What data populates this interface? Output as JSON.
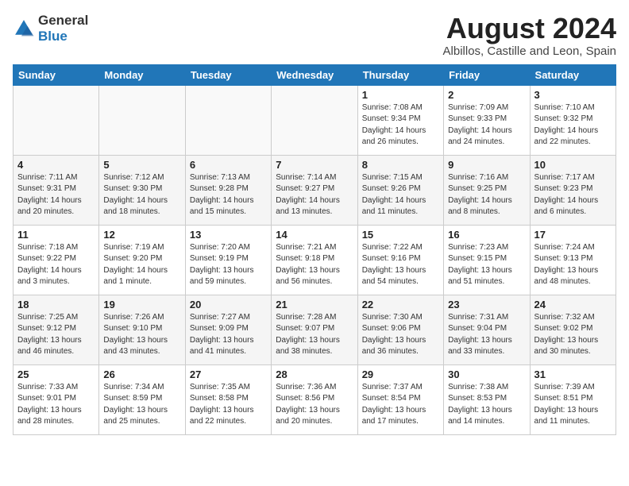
{
  "logo": {
    "text_general": "General",
    "text_blue": "Blue"
  },
  "title": {
    "month_year": "August 2024",
    "location": "Albillos, Castille and Leon, Spain"
  },
  "weekdays": [
    "Sunday",
    "Monday",
    "Tuesday",
    "Wednesday",
    "Thursday",
    "Friday",
    "Saturday"
  ],
  "weeks": [
    [
      {
        "day": "",
        "info": ""
      },
      {
        "day": "",
        "info": ""
      },
      {
        "day": "",
        "info": ""
      },
      {
        "day": "",
        "info": ""
      },
      {
        "day": "1",
        "info": "Sunrise: 7:08 AM\nSunset: 9:34 PM\nDaylight: 14 hours\nand 26 minutes."
      },
      {
        "day": "2",
        "info": "Sunrise: 7:09 AM\nSunset: 9:33 PM\nDaylight: 14 hours\nand 24 minutes."
      },
      {
        "day": "3",
        "info": "Sunrise: 7:10 AM\nSunset: 9:32 PM\nDaylight: 14 hours\nand 22 minutes."
      }
    ],
    [
      {
        "day": "4",
        "info": "Sunrise: 7:11 AM\nSunset: 9:31 PM\nDaylight: 14 hours\nand 20 minutes."
      },
      {
        "day": "5",
        "info": "Sunrise: 7:12 AM\nSunset: 9:30 PM\nDaylight: 14 hours\nand 18 minutes."
      },
      {
        "day": "6",
        "info": "Sunrise: 7:13 AM\nSunset: 9:28 PM\nDaylight: 14 hours\nand 15 minutes."
      },
      {
        "day": "7",
        "info": "Sunrise: 7:14 AM\nSunset: 9:27 PM\nDaylight: 14 hours\nand 13 minutes."
      },
      {
        "day": "8",
        "info": "Sunrise: 7:15 AM\nSunset: 9:26 PM\nDaylight: 14 hours\nand 11 minutes."
      },
      {
        "day": "9",
        "info": "Sunrise: 7:16 AM\nSunset: 9:25 PM\nDaylight: 14 hours\nand 8 minutes."
      },
      {
        "day": "10",
        "info": "Sunrise: 7:17 AM\nSunset: 9:23 PM\nDaylight: 14 hours\nand 6 minutes."
      }
    ],
    [
      {
        "day": "11",
        "info": "Sunrise: 7:18 AM\nSunset: 9:22 PM\nDaylight: 14 hours\nand 3 minutes."
      },
      {
        "day": "12",
        "info": "Sunrise: 7:19 AM\nSunset: 9:20 PM\nDaylight: 14 hours\nand 1 minute."
      },
      {
        "day": "13",
        "info": "Sunrise: 7:20 AM\nSunset: 9:19 PM\nDaylight: 13 hours\nand 59 minutes."
      },
      {
        "day": "14",
        "info": "Sunrise: 7:21 AM\nSunset: 9:18 PM\nDaylight: 13 hours\nand 56 minutes."
      },
      {
        "day": "15",
        "info": "Sunrise: 7:22 AM\nSunset: 9:16 PM\nDaylight: 13 hours\nand 54 minutes."
      },
      {
        "day": "16",
        "info": "Sunrise: 7:23 AM\nSunset: 9:15 PM\nDaylight: 13 hours\nand 51 minutes."
      },
      {
        "day": "17",
        "info": "Sunrise: 7:24 AM\nSunset: 9:13 PM\nDaylight: 13 hours\nand 48 minutes."
      }
    ],
    [
      {
        "day": "18",
        "info": "Sunrise: 7:25 AM\nSunset: 9:12 PM\nDaylight: 13 hours\nand 46 minutes."
      },
      {
        "day": "19",
        "info": "Sunrise: 7:26 AM\nSunset: 9:10 PM\nDaylight: 13 hours\nand 43 minutes."
      },
      {
        "day": "20",
        "info": "Sunrise: 7:27 AM\nSunset: 9:09 PM\nDaylight: 13 hours\nand 41 minutes."
      },
      {
        "day": "21",
        "info": "Sunrise: 7:28 AM\nSunset: 9:07 PM\nDaylight: 13 hours\nand 38 minutes."
      },
      {
        "day": "22",
        "info": "Sunrise: 7:30 AM\nSunset: 9:06 PM\nDaylight: 13 hours\nand 36 minutes."
      },
      {
        "day": "23",
        "info": "Sunrise: 7:31 AM\nSunset: 9:04 PM\nDaylight: 13 hours\nand 33 minutes."
      },
      {
        "day": "24",
        "info": "Sunrise: 7:32 AM\nSunset: 9:02 PM\nDaylight: 13 hours\nand 30 minutes."
      }
    ],
    [
      {
        "day": "25",
        "info": "Sunrise: 7:33 AM\nSunset: 9:01 PM\nDaylight: 13 hours\nand 28 minutes."
      },
      {
        "day": "26",
        "info": "Sunrise: 7:34 AM\nSunset: 8:59 PM\nDaylight: 13 hours\nand 25 minutes."
      },
      {
        "day": "27",
        "info": "Sunrise: 7:35 AM\nSunset: 8:58 PM\nDaylight: 13 hours\nand 22 minutes."
      },
      {
        "day": "28",
        "info": "Sunrise: 7:36 AM\nSunset: 8:56 PM\nDaylight: 13 hours\nand 20 minutes."
      },
      {
        "day": "29",
        "info": "Sunrise: 7:37 AM\nSunset: 8:54 PM\nDaylight: 13 hours\nand 17 minutes."
      },
      {
        "day": "30",
        "info": "Sunrise: 7:38 AM\nSunset: 8:53 PM\nDaylight: 13 hours\nand 14 minutes."
      },
      {
        "day": "31",
        "info": "Sunrise: 7:39 AM\nSunset: 8:51 PM\nDaylight: 13 hours\nand 11 minutes."
      }
    ]
  ]
}
